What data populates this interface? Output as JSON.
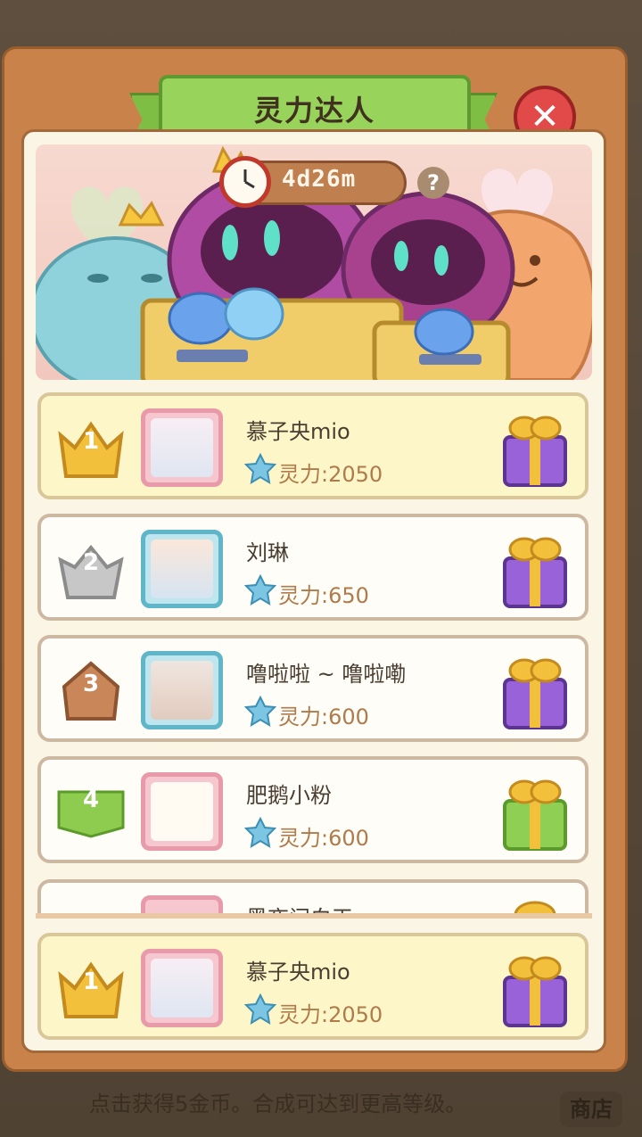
{
  "background": {
    "bottom_text": "点击获得5金币。合成可达到更高等级。",
    "shop_label": "商店"
  },
  "header": {
    "title": "灵力达人",
    "timer": "4d26m",
    "help_label": "?"
  },
  "rankings": [
    {
      "rank": "1",
      "name": "慕子央mio",
      "score": "灵力:2050",
      "medal": "gold-crown",
      "gift_color": "purple"
    },
    {
      "rank": "2",
      "name": "刘琳",
      "score": "灵力:650",
      "medal": "silver-crown",
      "gift_color": "purple"
    },
    {
      "rank": "3",
      "name": "噜啦啦 ~ 噜啦嘞",
      "score": "灵力:600",
      "medal": "bronze-crown",
      "gift_color": "purple"
    },
    {
      "rank": "4",
      "name": "肥鹅小粉",
      "score": "灵力:600",
      "medal": "green-flag",
      "gift_color": "green"
    },
    {
      "rank": "",
      "name": "黑夜问白天",
      "score": "",
      "medal": "green-flag",
      "gift_color": "purple"
    }
  ],
  "my_rank": {
    "rank": "1",
    "name": "慕子央mio",
    "score": "灵力:2050"
  },
  "colors": {
    "panel": "#c9834a",
    "title_green": "#98d45c",
    "gold_row": "#fdf6c8",
    "score_text": "#b07a4a",
    "close_red": "#e24a4a"
  }
}
